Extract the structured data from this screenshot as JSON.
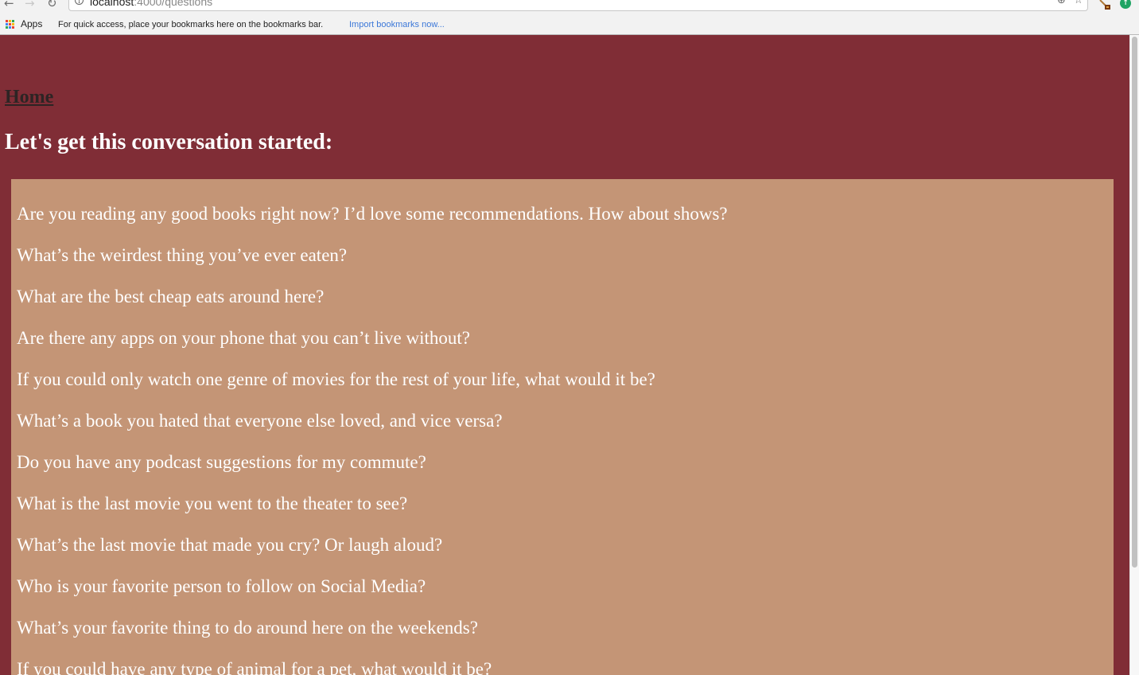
{
  "browser": {
    "url_host": "localhost",
    "url_path": ":4000/questions",
    "bookmarks_bar": {
      "apps_label": "Apps",
      "hint": "For quick access, place your bookmarks here on the bookmarks bar.",
      "import_link": "Import bookmarks now..."
    },
    "icons": {
      "back": "back-arrow-icon",
      "forward": "forward-arrow-icon",
      "reload": "reload-icon",
      "info": "info-icon",
      "zoom": "zoom-icon",
      "star": "bookmark-star-icon",
      "extension": "extension-icon",
      "update": "update-available-icon"
    }
  },
  "page": {
    "home_link": "Home",
    "heading": "Let's get this conversation started:",
    "colors": {
      "background": "#802d36",
      "questions_box": "#c49576",
      "question_text": "#ffffff",
      "home_link": "#2d2424"
    },
    "questions": [
      "Are you reading any good books right now? I’d love some recommendations. How about shows?",
      "What’s the weirdest thing you’ve ever eaten?",
      "What are the best cheap eats around here?",
      "Are there any apps on your phone that you can’t live without?",
      "If you could only watch one genre of movies for the rest of your life, what would it be?",
      "What’s a book you hated that everyone else loved, and vice versa?",
      "Do you have any podcast suggestions for my commute?",
      "What is the last movie you went to the theater to see?",
      "What’s the last movie that made you cry? Or laugh aloud?",
      "Who is your favorite person to follow on Social Media?",
      "What’s your favorite thing to do around here on the weekends?",
      "If you could have any type of animal for a pet, what would it be?"
    ]
  }
}
